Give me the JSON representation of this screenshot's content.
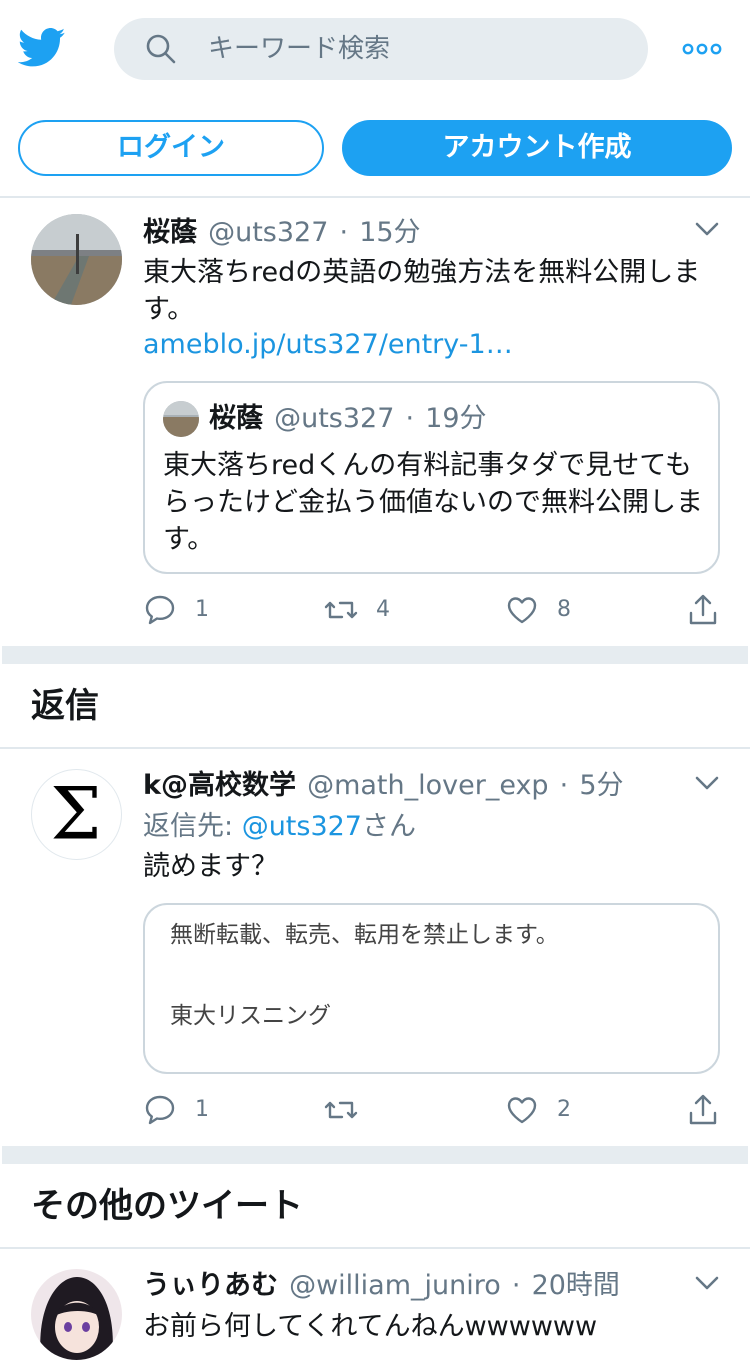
{
  "header": {
    "search_placeholder": "キーワード検索",
    "login_label": "ログイン",
    "signup_label": "アカウント作成"
  },
  "main_tweet": {
    "name": "桜蔭",
    "handle": "@uts327",
    "time": "15分",
    "text": "東大落ちredの英語の勉強方法を無料公開します。",
    "link": "ameblo.jp/uts327/entry-1…",
    "quote": {
      "name": "桜蔭",
      "handle": "@uts327",
      "time": "19分",
      "text": "東大落ちredくんの有料記事タダで見せてもらったけど金払う価値ないので無料公開します。"
    },
    "replies": "1",
    "retweets": "4",
    "likes": "8"
  },
  "replies_section": {
    "title": "返信",
    "tweet": {
      "name": "k@高校数学",
      "handle": "@math_lover_exp",
      "time": "5分",
      "reply_prefix": "返信先: ",
      "reply_to": "@uts327",
      "reply_suffix": "さん",
      "text": "読めます？",
      "card_line1": "無断転載、転売、転用を禁止します。",
      "card_line2": "東大リスニング",
      "replies": "1",
      "retweets": "",
      "likes": "2"
    }
  },
  "more_section": {
    "title": "その他のツイート",
    "tweet": {
      "name": "うぃりあむ",
      "handle": "@william_juniro",
      "time": "20時間",
      "text": "お前ら何してくれてんねんwwwwww"
    }
  },
  "colors": {
    "accent": "#1da1f2",
    "link": "#1b95e0",
    "muted": "#657786"
  }
}
